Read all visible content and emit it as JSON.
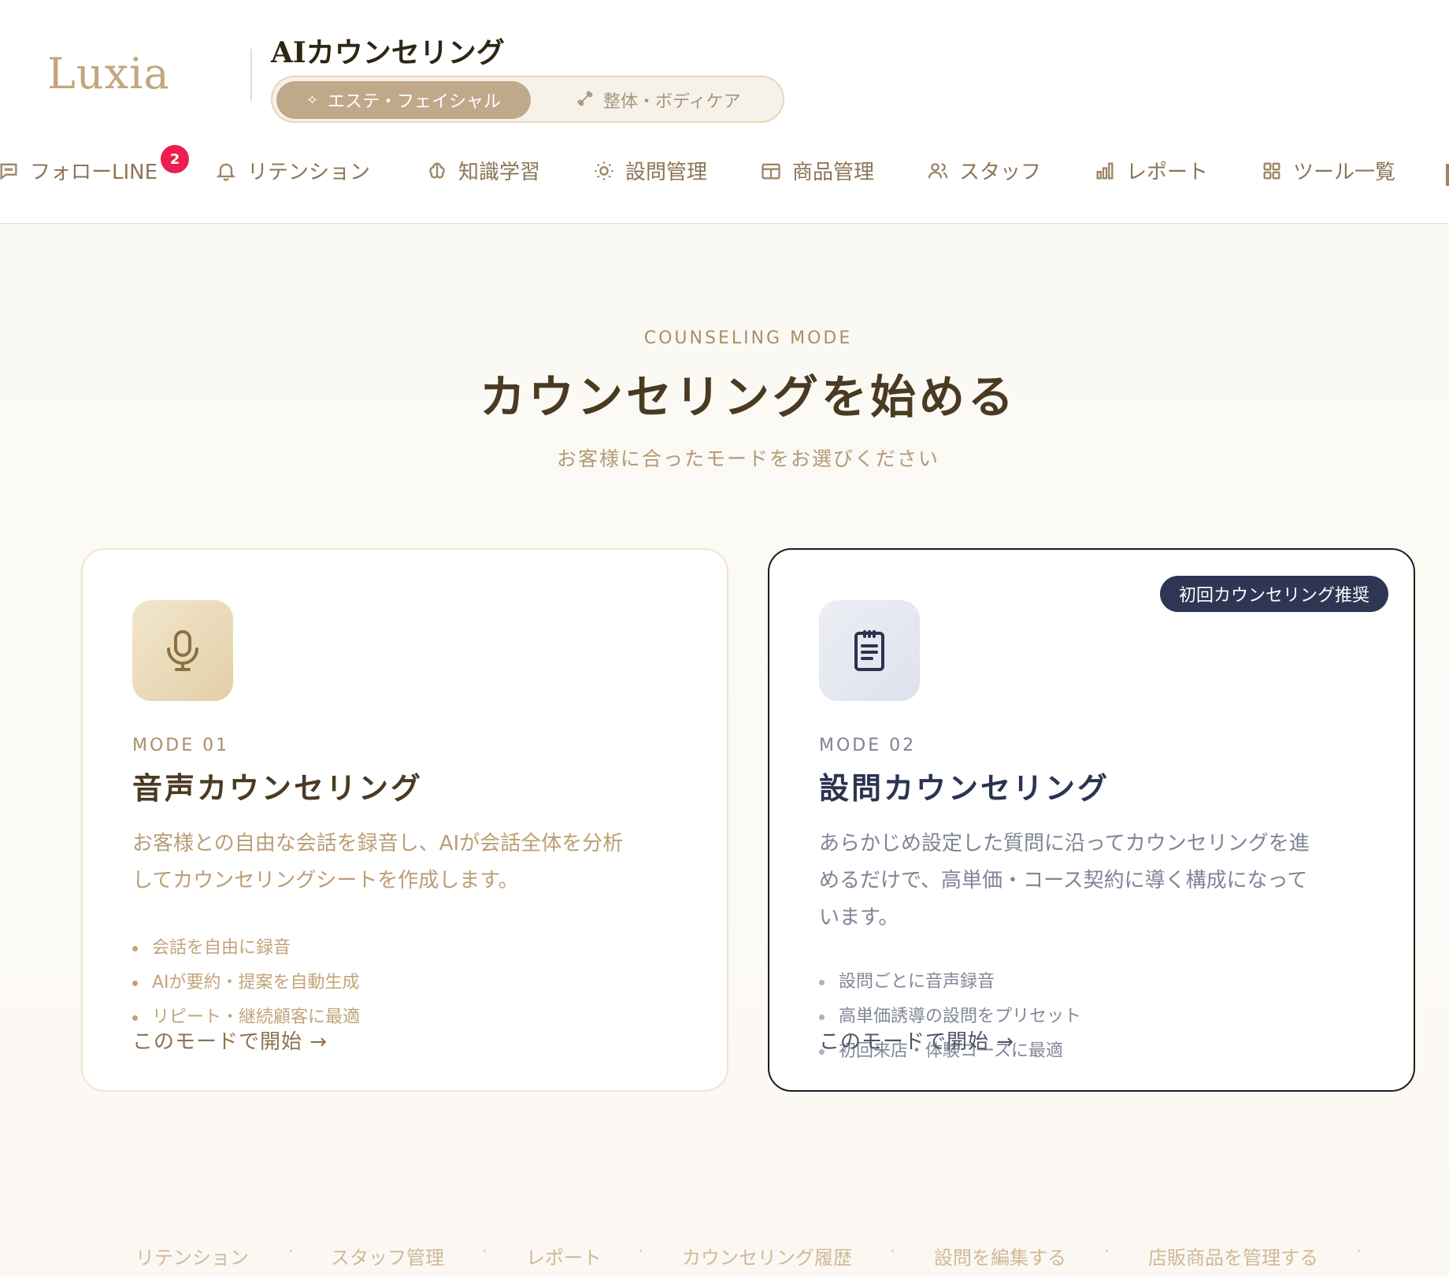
{
  "brand": {
    "logo": "Luxia"
  },
  "header": {
    "title": "AIカウンセリング",
    "segments": [
      {
        "label": "エステ・フェイシャル",
        "icon": "sparkle-icon",
        "active": true
      },
      {
        "label": "整体・ボディケア",
        "icon": "bone-icon",
        "active": false
      }
    ]
  },
  "nav": {
    "items": [
      {
        "label": "フォローLINE",
        "icon": "chat-icon",
        "badge": "2"
      },
      {
        "label": "リテンション",
        "icon": "bell-icon"
      },
      {
        "label": "知識学習",
        "icon": "brain-icon"
      },
      {
        "label": "設問管理",
        "icon": "sun-icon"
      },
      {
        "label": "商品管理",
        "icon": "table-icon"
      },
      {
        "label": "スタッフ",
        "icon": "users-icon"
      },
      {
        "label": "レポート",
        "icon": "bar-chart-icon"
      },
      {
        "label": "ツール一覧",
        "icon": "grid-icon"
      }
    ]
  },
  "main": {
    "eyebrow": "COUNSELING MODE",
    "title": "カウンセリングを始める",
    "subtitle": "お客様に合ったモードをお選びください"
  },
  "cards": [
    {
      "mode": "MODE 01",
      "title": "音声カウンセリング",
      "icon": "microphone-icon",
      "desc_lines": [
        "お客様との自由な会話を録音し、AIが会話全体を分析",
        "してカウンセリングシートを作成します。"
      ],
      "bullets": [
        "会話を自由に録音",
        "AIが要約・提案を自動生成",
        "リピート・継続顧客に最適"
      ],
      "cta": "このモードで開始 →"
    },
    {
      "mode": "MODE 02",
      "title": "設問カウンセリング",
      "icon": "clipboard-icon",
      "badge": "初回カウンセリング推奨",
      "desc_lines": [
        "あらかじめ設定した質問に沿ってカウンセリングを進",
        "めるだけで、高単価・コース契約に導く構成になって",
        "います。"
      ],
      "bullets": [
        "設問ごとに音声録音",
        "高単価誘導の設問をプリセット",
        "初回来店・体験コースに最適"
      ],
      "cta": "このモードで開始 →"
    }
  ],
  "footer": {
    "links": [
      "リテンション",
      "スタッフ管理",
      "レポート",
      "カウンセリング履歴",
      "設問を編集する",
      "店販商品を管理する"
    ],
    "separator": "·"
  },
  "colors": {
    "accent": "#c0a98b",
    "badge_red": "#ec1f4e",
    "navy": "#2e3654"
  }
}
